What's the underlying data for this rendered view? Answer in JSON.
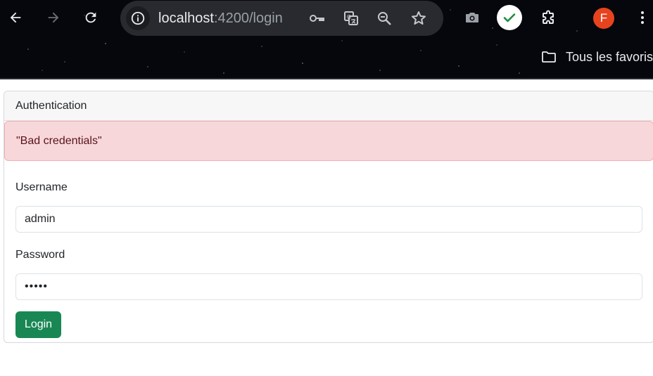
{
  "browser": {
    "url_host": "localhost",
    "url_rest": ":4200/login",
    "bookmark_folder_label": "Tous les favoris",
    "profile_initial": "F",
    "profile_color": "#e8431f"
  },
  "card": {
    "header_title": "Authentication",
    "alert_message": "\"Bad credentials\"",
    "alert_background": "#f8d7da"
  },
  "form": {
    "username_label": "Username",
    "username_value": "admin",
    "password_label": "Password",
    "password_mask": "•••••",
    "login_label": "Login",
    "login_color": "#198754"
  }
}
